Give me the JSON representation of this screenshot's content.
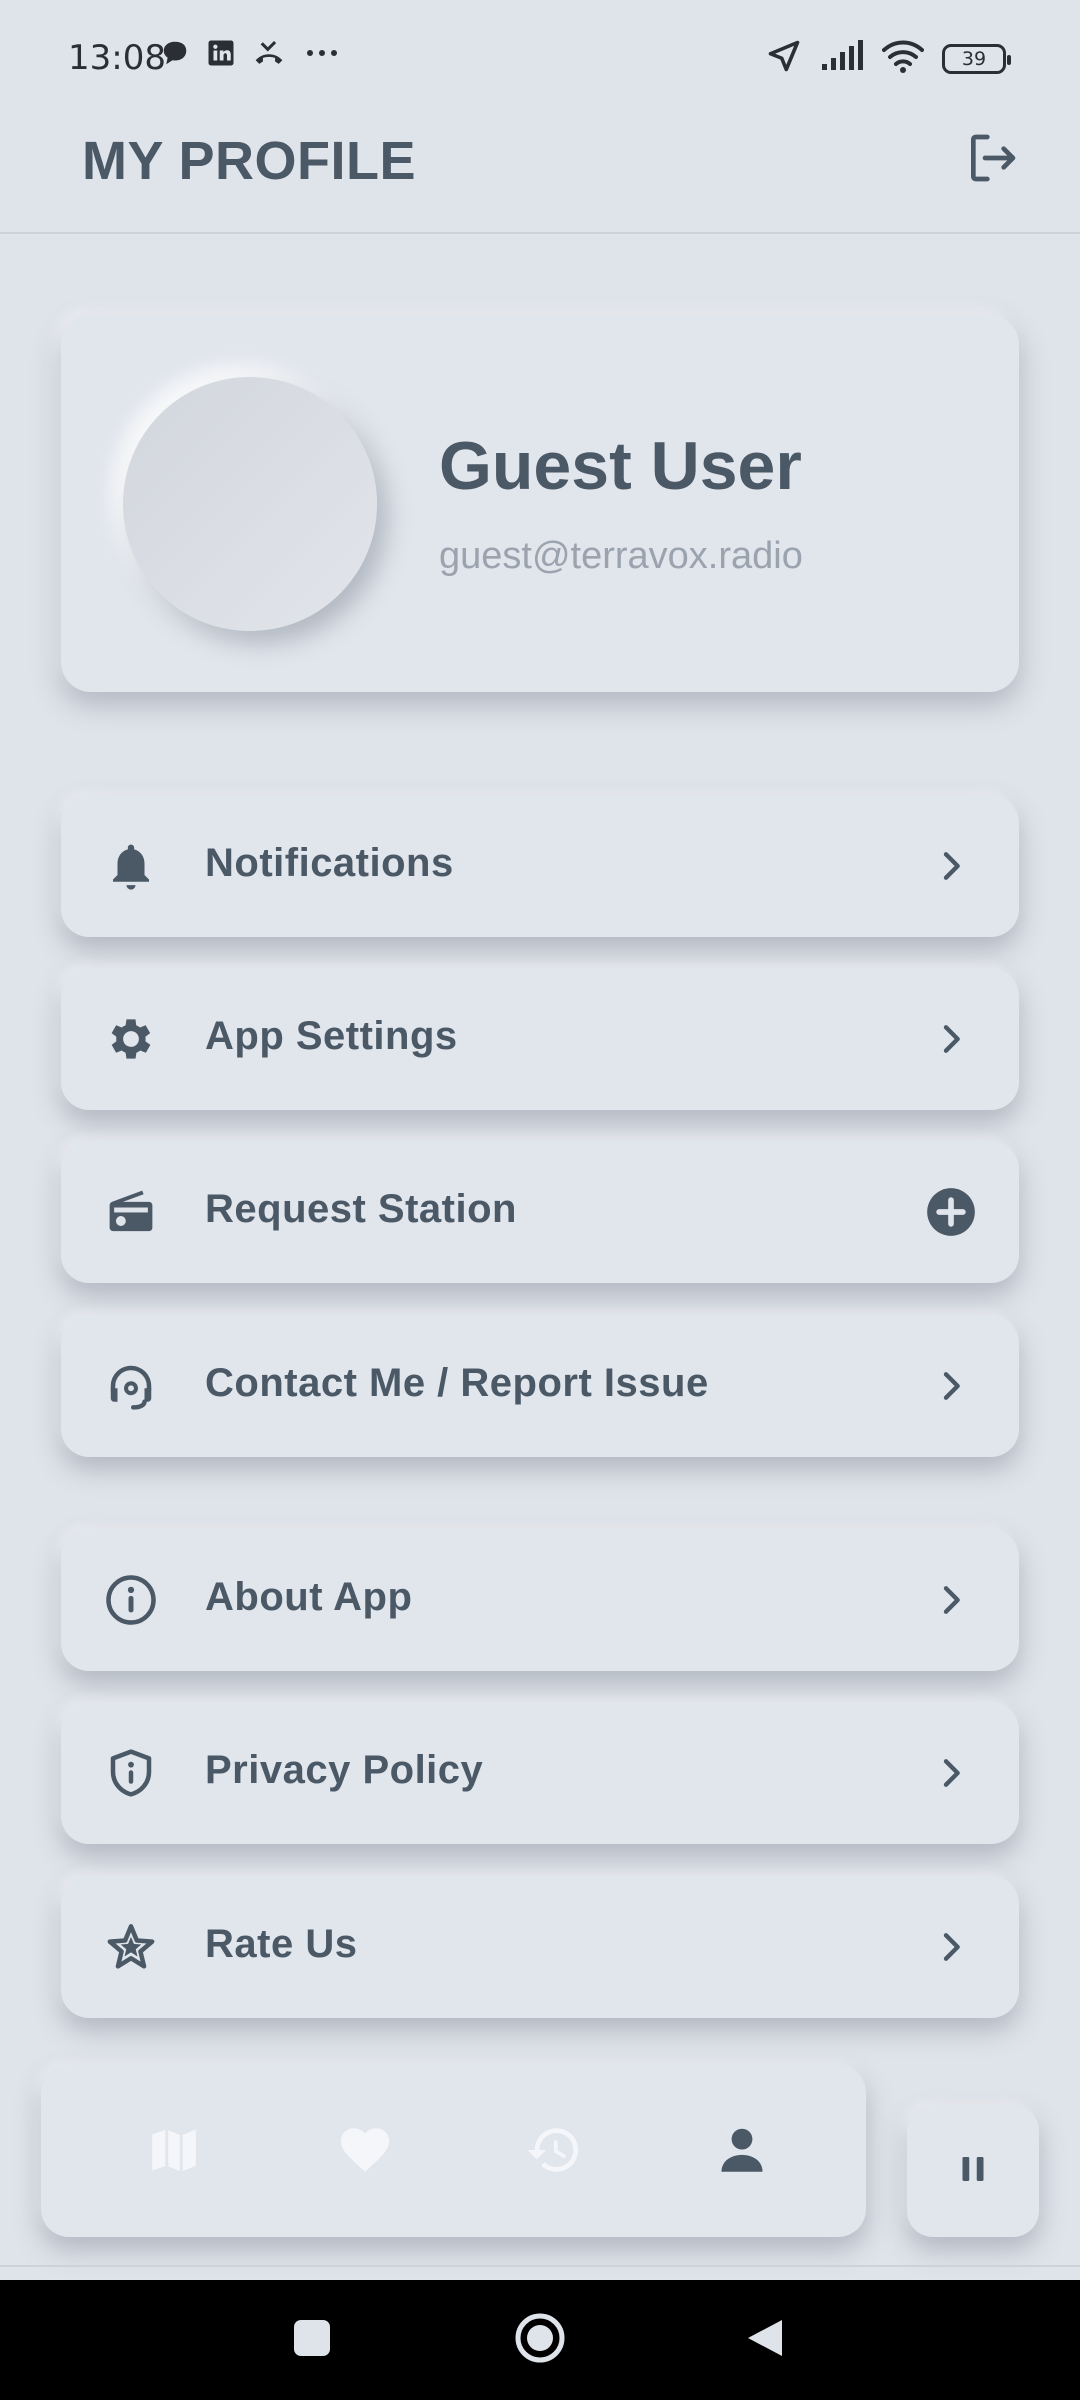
{
  "status_bar": {
    "time": "13:08",
    "battery": "39",
    "left_icons": [
      "chat-bubble-icon",
      "linkedin-icon",
      "missed-call-icon",
      "more-dots-icon"
    ],
    "right_icons": [
      "location-arrow-icon",
      "signal-bars-icon",
      "wifi-icon",
      "battery-icon"
    ]
  },
  "header": {
    "title": "MY PROFILE",
    "logout_icon": "logout-icon"
  },
  "profile": {
    "name": "Guest User",
    "email": "guest@terravox.radio"
  },
  "menu": {
    "items": [
      {
        "label": "Notifications",
        "icon": "bell-icon",
        "trail": "chevron-right-icon"
      },
      {
        "label": "App Settings",
        "icon": "gear-icon",
        "trail": "chevron-right-icon"
      },
      {
        "label": "Request Station",
        "icon": "radio-icon",
        "trail": "plus-circle-icon"
      },
      {
        "label": "Contact Me / Report Issue",
        "icon": "headset-icon",
        "trail": "chevron-right-icon"
      },
      {
        "label": "About App",
        "icon": "info-circle-icon",
        "trail": "chevron-right-icon"
      },
      {
        "label": "Privacy Policy",
        "icon": "shield-info-icon",
        "trail": "chevron-right-icon"
      },
      {
        "label": "Rate Us",
        "icon": "star-outline-icon",
        "trail": "chevron-right-icon"
      }
    ]
  },
  "bottom_nav": {
    "items": [
      {
        "icon": "map-icon",
        "active": false
      },
      {
        "icon": "heart-icon",
        "active": false
      },
      {
        "icon": "history-icon",
        "active": false
      },
      {
        "icon": "person-icon",
        "active": true
      }
    ],
    "player_icon": "pause-icon"
  },
  "colors": {
    "background": "#dfe3ea",
    "card": "#e1e5ec",
    "primary_text": "#4b5866",
    "secondary_text": "#9aa3ae",
    "inactive_icon": "#f4f6f9"
  }
}
